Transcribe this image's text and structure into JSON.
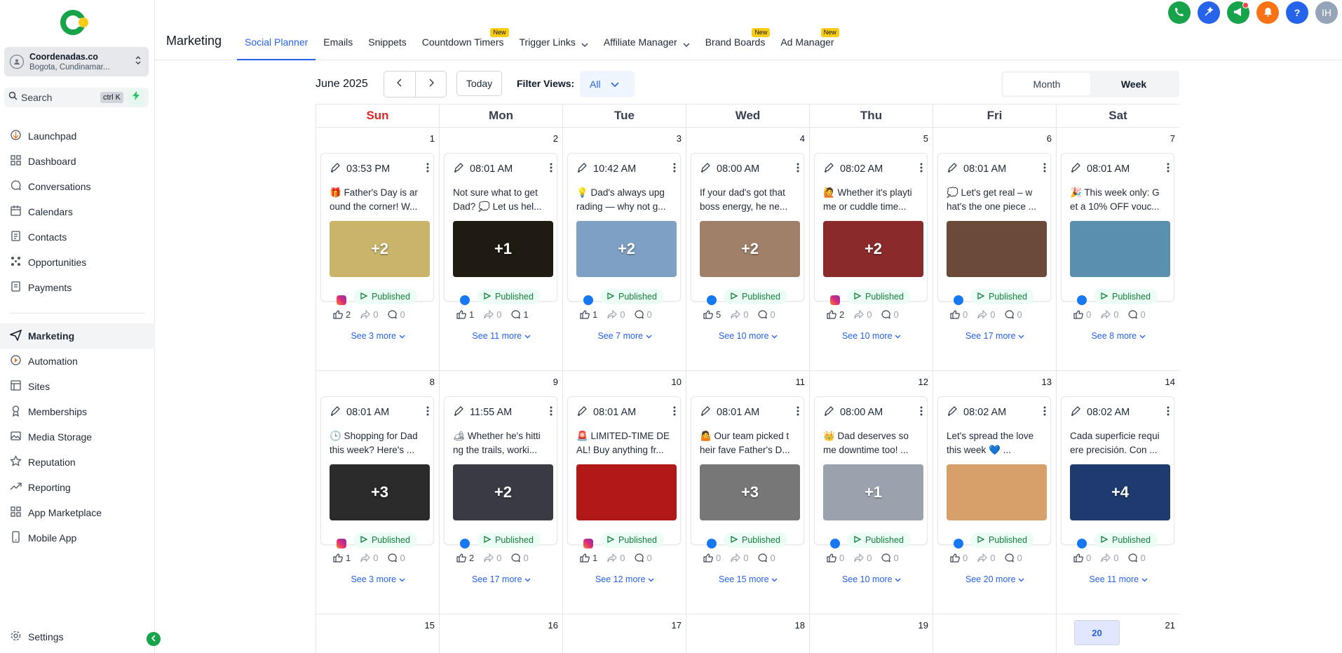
{
  "account": {
    "name": "Coordenadas.co",
    "location": "Bogota, Cundinamar..."
  },
  "search": {
    "label": "Search",
    "shortcut": "ctrl K"
  },
  "sidebar": {
    "items": [
      {
        "label": "Launchpad",
        "icon": "launchpad-icon"
      },
      {
        "label": "Dashboard",
        "icon": "dashboard-icon"
      },
      {
        "label": "Conversations",
        "icon": "chat-icon"
      },
      {
        "label": "Calendars",
        "icon": "calendar-icon"
      },
      {
        "label": "Contacts",
        "icon": "contacts-icon"
      },
      {
        "label": "Opportunities",
        "icon": "opportunities-icon"
      },
      {
        "label": "Payments",
        "icon": "payments-icon"
      }
    ],
    "items2": [
      {
        "label": "Marketing",
        "icon": "send-icon"
      },
      {
        "label": "Automation",
        "icon": "automation-icon"
      },
      {
        "label": "Sites",
        "icon": "sites-icon"
      },
      {
        "label": "Memberships",
        "icon": "memberships-icon"
      },
      {
        "label": "Media Storage",
        "icon": "image-icon"
      },
      {
        "label": "Reputation",
        "icon": "star-icon"
      },
      {
        "label": "Reporting",
        "icon": "trend-icon"
      },
      {
        "label": "App Marketplace",
        "icon": "apps-icon"
      },
      {
        "label": "Mobile App",
        "icon": "mobile-icon"
      }
    ],
    "settings": "Settings"
  },
  "header": {
    "title": "Marketing",
    "tabs": [
      {
        "label": "Social Planner",
        "new": false,
        "dropdown": false
      },
      {
        "label": "Emails",
        "new": false,
        "dropdown": false
      },
      {
        "label": "Snippets",
        "new": false,
        "dropdown": false
      },
      {
        "label": "Countdown Timers",
        "new": true,
        "dropdown": false
      },
      {
        "label": "Trigger Links",
        "new": false,
        "dropdown": true
      },
      {
        "label": "Affiliate Manager",
        "new": false,
        "dropdown": true
      },
      {
        "label": "Brand Boards",
        "new": true,
        "dropdown": false
      },
      {
        "label": "Ad Manager",
        "new": true,
        "dropdown": false
      }
    ],
    "new_badge": "New",
    "avatar": "IH"
  },
  "toolbar": {
    "month": "June 2025",
    "today": "Today",
    "filter_label": "Filter Views:",
    "filter_value": "All",
    "view_month": "Month",
    "view_week": "Week"
  },
  "calendar": {
    "days": [
      "Sun",
      "Mon",
      "Tue",
      "Wed",
      "Thu",
      "Fri",
      "Sat"
    ],
    "status": "Published",
    "weeks": [
      [
        {
          "n": "1",
          "time": "03:53 PM",
          "text": "🎁 Father's Day is ar ound the corner! W...",
          "more": "+2",
          "net": "instagram",
          "likes": "2",
          "shares": "0",
          "comments": "0",
          "see": "See 3 more",
          "img": "#c9b46a"
        },
        {
          "n": "2",
          "time": "08:01 AM",
          "text": "Not sure what to get Dad? 💭 Let us hel...",
          "more": "+1",
          "net": "facebook",
          "likes": "1",
          "shares": "0",
          "comments": "1",
          "see": "See 11 more",
          "img": "#1f1a12"
        },
        {
          "n": "3",
          "time": "10:42 AM",
          "text": "💡 Dad's always upg rading — why not g...",
          "more": "+2",
          "net": "facebook",
          "likes": "1",
          "shares": "0",
          "comments": "0",
          "see": "See 7 more",
          "img": "#7ea0c4"
        },
        {
          "n": "4",
          "time": "08:00 AM",
          "text": "If your dad's got that boss energy, he ne...",
          "more": "+2",
          "net": "facebook",
          "likes": "5",
          "shares": "0",
          "comments": "0",
          "see": "See 10 more",
          "img": "#a08068"
        },
        {
          "n": "5",
          "time": "08:02 AM",
          "text": "🙋 Whether it's playti me or cuddle time...",
          "more": "+2",
          "net": "instagram",
          "likes": "2",
          "shares": "0",
          "comments": "0",
          "see": "See 10 more",
          "img": "#8a2a2a"
        },
        {
          "n": "6",
          "time": "08:01 AM",
          "text": "💭 Let's get real – w hat's the one piece ...",
          "more": "",
          "net": "facebook",
          "likes": "0",
          "shares": "0",
          "comments": "0",
          "see": "See 17 more",
          "img": "#6b4a3a"
        },
        {
          "n": "7",
          "time": "08:01 AM",
          "text": "🎉 This week only: G et a 10% OFF vouc...",
          "more": "",
          "net": "facebook",
          "likes": "0",
          "shares": "0",
          "comments": "0",
          "see": "See 8 more",
          "img": "#5b8fb0"
        }
      ],
      [
        {
          "n": "8",
          "time": "08:01 AM",
          "text": "🕒 Shopping for Dad this week? Here's ...",
          "more": "+3",
          "net": "instagram",
          "likes": "1",
          "shares": "0",
          "comments": "0",
          "see": "See 3 more",
          "img": "#2a2a2a"
        },
        {
          "n": "9",
          "time": "11:55 AM",
          "text": "🏕 Whether he's hitti ng the trails, worki...",
          "more": "+2",
          "net": "facebook",
          "likes": "2",
          "shares": "0",
          "comments": "0",
          "see": "See 17 more",
          "img": "#3a3a44"
        },
        {
          "n": "10",
          "time": "08:01 AM",
          "text": "🚨 LIMITED-TIME DE AL! Buy anything fr...",
          "more": "",
          "net": "instagram",
          "likes": "1",
          "shares": "0",
          "comments": "0",
          "see": "See 12 more",
          "img": "#b01818"
        },
        {
          "n": "11",
          "time": "08:01 AM",
          "text": "🤷 Our team picked t heir fave Father's D...",
          "more": "+3",
          "net": "facebook",
          "likes": "0",
          "shares": "0",
          "comments": "0",
          "see": "See 15 more",
          "img": "#777"
        },
        {
          "n": "12",
          "time": "08:00 AM",
          "text": "👑 Dad deserves so me downtime too! ...",
          "more": "+1",
          "net": "facebook",
          "likes": "0",
          "shares": "0",
          "comments": "0",
          "see": "See 10 more",
          "img": "#9aa3ad"
        },
        {
          "n": "13",
          "time": "08:02 AM",
          "text": "Let's spread the love this week 💙 ...",
          "more": "",
          "net": "facebook",
          "likes": "0",
          "shares": "0",
          "comments": "0",
          "see": "See 20 more",
          "img": "#d7a06a"
        },
        {
          "n": "14",
          "time": "08:02 AM",
          "text": "Cada superficie requi ere precisión. Con ...",
          "more": "+4",
          "net": "facebook",
          "likes": "0",
          "shares": "0",
          "comments": "0",
          "see": "See 11 more",
          "img": "#1e3a6e"
        }
      ]
    ],
    "week3": [
      "15",
      "16",
      "17",
      "18",
      "19",
      "20",
      "21"
    ],
    "today_num": "20"
  },
  "colors": {
    "accent": "#2563eb",
    "published": "#15803d",
    "sunday": "#dc2626",
    "facebook": "#1877f2",
    "instagram": "#d6249f"
  }
}
